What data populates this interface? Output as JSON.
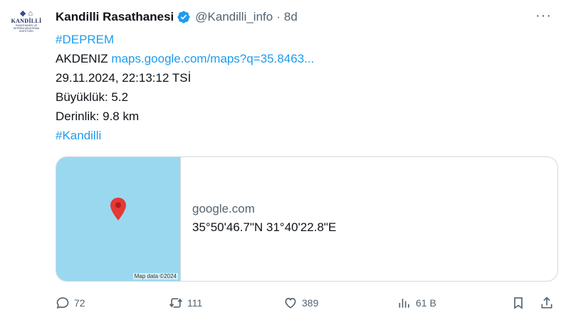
{
  "author": {
    "name": "Kandilli Rasathanesi",
    "handle": "@Kandilli_info",
    "time": "8d",
    "avatar_text": "KANDİLLİ",
    "avatar_sub": "RASATHANESİ VE DEPREM ARAŞTIRMA ENSTİTÜSÜ"
  },
  "tweet": {
    "hashtag1": "#DEPREM",
    "location": "AKDENIZ ",
    "map_link": "maps.google.com/maps?q=35.8463...",
    "datetime": "29.11.2024, 22:13:12 TSİ",
    "magnitude": "Büyüklük: 5.2",
    "depth": "Derinlik: 9.8 km",
    "hashtag2": "#Kandilli"
  },
  "card": {
    "domain": "google.com",
    "title": "35°50'46.7\"N 31°40'22.8\"E",
    "map_credit": "Map data ©2024"
  },
  "actions": {
    "replies": "72",
    "reposts": "111",
    "likes": "389",
    "views": "61 B"
  },
  "colors": {
    "link": "#1d9bf0",
    "muted": "#536471",
    "map_water": "#9ad8f0",
    "pin": "#e53935"
  },
  "icons": [
    "verified-badge-icon",
    "more-icon",
    "map-pin-icon",
    "reply-icon",
    "repost-icon",
    "like-icon",
    "views-icon",
    "bookmark-icon",
    "share-icon"
  ]
}
